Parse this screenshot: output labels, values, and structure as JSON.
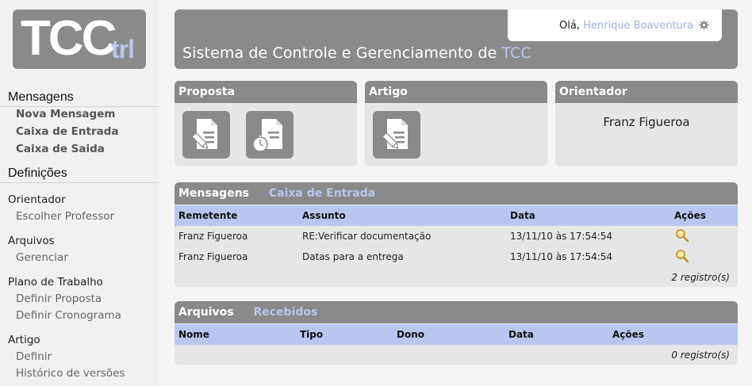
{
  "logo": {
    "main": "TCC",
    "sub": "trl"
  },
  "header": {
    "greeting": "Olá,",
    "user_name": "Henrique Boaventura",
    "system_title": "Sistema de Controle e Gerenciamento de",
    "system_title_highlight": "TCC"
  },
  "sidebar": {
    "messages_title": "Mensagens",
    "new_message": "Nova Mensagem",
    "inbox": "Caixa de Entrada",
    "outbox": "Caixa de Saida",
    "settings_title": "Definições",
    "groups": [
      {
        "title": "Orientador",
        "links": [
          "Escolher Professor"
        ]
      },
      {
        "title": "Arquivos",
        "links": [
          "Gerenciar"
        ]
      },
      {
        "title": "Plano de Trabalho",
        "links": [
          "Definir Proposta",
          "Definir Cronograma"
        ]
      },
      {
        "title": "Artigo",
        "links": [
          "Definir",
          "Histórico de versões"
        ]
      }
    ]
  },
  "cards": {
    "proposta": {
      "title": "Proposta"
    },
    "artigo": {
      "title": "Artigo"
    },
    "orientador": {
      "title": "Orientador",
      "name": "Franz Figueroa"
    }
  },
  "messages_panel": {
    "title": "Mensagens",
    "tab": "Caixa de Entrada",
    "columns": [
      "Remetente",
      "Assunto",
      "Data",
      "Ações"
    ],
    "rows": [
      {
        "sender": "Franz Figueroa",
        "subject": "RE:Verificar documentação",
        "date": "13/11/10 às 17:54:54"
      },
      {
        "sender": "Franz Figueroa",
        "subject": "Datas para a entrega",
        "date": "13/11/10 às 17:54:54"
      }
    ],
    "count": "2 registro(s)"
  },
  "files_panel": {
    "title": "Arquivos",
    "tab": "Recebidos",
    "columns": [
      "Nome",
      "Tipo",
      "Dono",
      "Data",
      "Ações"
    ],
    "count": "0 registro(s)"
  },
  "icons": {
    "edit_document": "edit-document-icon",
    "schedule_document": "schedule-document-icon",
    "view": "magnifier-icon",
    "settings": "gear-icon"
  },
  "colors": {
    "header_gray": "#8a8a8a",
    "accent_blue": "#b9c7ee",
    "panel_bg": "#e6e6e6"
  }
}
